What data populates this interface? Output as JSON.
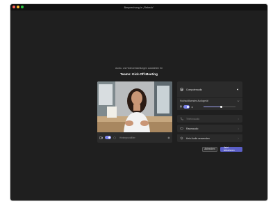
{
  "window": {
    "title": "Besprechung in „Rebeck“"
  },
  "prejoin": {
    "subtitle": "Audio- und Videoeinstellungen auswählen für",
    "meeting_title": "Teams: Kick-Off-Meeting"
  },
  "video": {
    "camera_on": true,
    "background_filters_label": "Hintergrundfilter"
  },
  "audio": {
    "computer_audio_label": "Computeraudio",
    "device_label": "Hochauflösendes Audiogerät",
    "mic_on": true,
    "speaker_volume": 0.55,
    "phone_audio_label": "Telefonaudio",
    "room_audio_label": "Raumaudio",
    "no_audio_label": "Kein Audio verwenden"
  },
  "actions": {
    "cancel_label": "Abbrechen",
    "join_label": "Jetzt teilnehmen"
  },
  "colors": {
    "accent": "#5b5fc7",
    "toggle_on": "#7b83eb",
    "surface": "#2b2b2b",
    "background": "#1f1f1f"
  }
}
